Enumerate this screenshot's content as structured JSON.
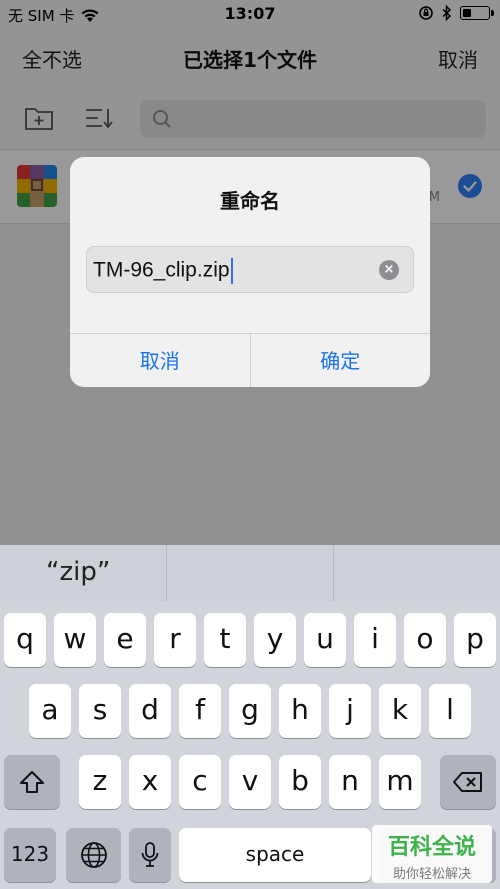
{
  "status_bar": {
    "carrier": "无 SIM 卡",
    "time": "13:07",
    "battery_level": 0.35
  },
  "nav": {
    "left": "全不选",
    "title": "已选择1个文件",
    "right": "取消"
  },
  "file": {
    "meta": "M"
  },
  "dialog": {
    "title": "重命名",
    "input_value": "TM-96_clip.zip",
    "cancel": "取消",
    "confirm": "确定"
  },
  "keyboard": {
    "suggestions": [
      "“zip”",
      "",
      ""
    ],
    "row1": [
      "q",
      "w",
      "e",
      "r",
      "t",
      "y",
      "u",
      "i",
      "o",
      "p"
    ],
    "row2": [
      "a",
      "s",
      "d",
      "f",
      "g",
      "h",
      "j",
      "k",
      "l"
    ],
    "row3": [
      "z",
      "x",
      "c",
      "v",
      "b",
      "n",
      "m"
    ],
    "numbers": "123",
    "space": "space"
  },
  "watermark": {
    "title": "百科全说",
    "subtitle": "助你轻松解决"
  },
  "icons": {
    "wifi": "wifi-icon",
    "lock": "orientation-lock-icon",
    "bluetooth": "bluetooth-icon",
    "new_folder": "new-folder-icon",
    "sort": "sort-icon",
    "search": "search-icon",
    "shift": "shift-icon",
    "delete": "backspace-icon",
    "globe": "globe-icon",
    "mic": "microphone-icon"
  },
  "colors": {
    "accent": "#1a73e8",
    "check": "#2f7ff7",
    "watermark_green": "#3cb34a"
  }
}
